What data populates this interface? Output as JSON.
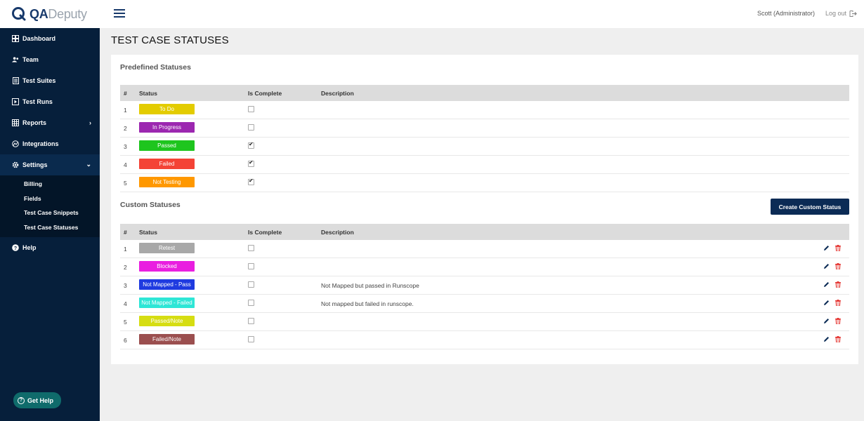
{
  "brand": {
    "qa": "QA",
    "deputy": "Deputy"
  },
  "sidebar": {
    "items": [
      {
        "label": "Dashboard",
        "icon": "dashboard-icon"
      },
      {
        "label": "Team",
        "icon": "team-icon"
      },
      {
        "label": "Test Suites",
        "icon": "test-suites-icon"
      },
      {
        "label": "Test Runs",
        "icon": "test-runs-icon"
      },
      {
        "label": "Reports",
        "icon": "reports-icon"
      },
      {
        "label": "Integrations",
        "icon": "integrations-icon"
      },
      {
        "label": "Settings",
        "icon": "gear-icon"
      }
    ],
    "settings_sub": [
      "Billing",
      "Fields",
      "Test Case Snippets",
      "Test Case Statuses"
    ],
    "help": "Help",
    "get_help": "Get Help"
  },
  "header": {
    "user": "Scott (Administrator)",
    "logout": "Log out"
  },
  "page": {
    "title": "TEST CASE STATUSES"
  },
  "predefined": {
    "title": "Predefined Statuses",
    "columns": [
      "#",
      "Status",
      "Is Complete",
      "Description"
    ],
    "rows": [
      {
        "num": "1",
        "status": "To Do",
        "color": "#e3cc00",
        "complete": false,
        "description": ""
      },
      {
        "num": "2",
        "status": "In Progress",
        "color": "#9c27b0",
        "complete": false,
        "description": ""
      },
      {
        "num": "3",
        "status": "Passed",
        "color": "#1ec51e",
        "complete": true,
        "description": ""
      },
      {
        "num": "4",
        "status": "Failed",
        "color": "#f44336",
        "complete": true,
        "description": ""
      },
      {
        "num": "5",
        "status": "Not Testing",
        "color": "#ff9800",
        "complete": true,
        "description": ""
      }
    ]
  },
  "custom": {
    "title": "Custom Statuses",
    "create_button": "Create Custom Status",
    "columns": [
      "#",
      "Status",
      "Is Complete",
      "Description"
    ],
    "rows": [
      {
        "num": "1",
        "status": "Retest",
        "color": "#a8a8a8",
        "complete": false,
        "description": ""
      },
      {
        "num": "2",
        "status": "Blocked",
        "color": "#e91ee0",
        "complete": false,
        "description": ""
      },
      {
        "num": "3",
        "status": "Not Mapped - Pass",
        "color": "#1f3be0",
        "complete": false,
        "description": "Not Mapped but passed in Runscope"
      },
      {
        "num": "4",
        "status": "Not Mapped - Failed",
        "color": "#2ee6d6",
        "complete": false,
        "description": "Not mapped but failed in runscope."
      },
      {
        "num": "5",
        "status": "Passed/Note",
        "color": "#d6dd12",
        "complete": false,
        "description": ""
      },
      {
        "num": "6",
        "status": "Failed/Note",
        "color": "#9b4f4f",
        "complete": false,
        "description": ""
      }
    ]
  },
  "colors": {
    "sidebar": "#061f3b",
    "accent": "#0b2b55",
    "edit": "#0b2b55",
    "delete": "#e53935"
  }
}
